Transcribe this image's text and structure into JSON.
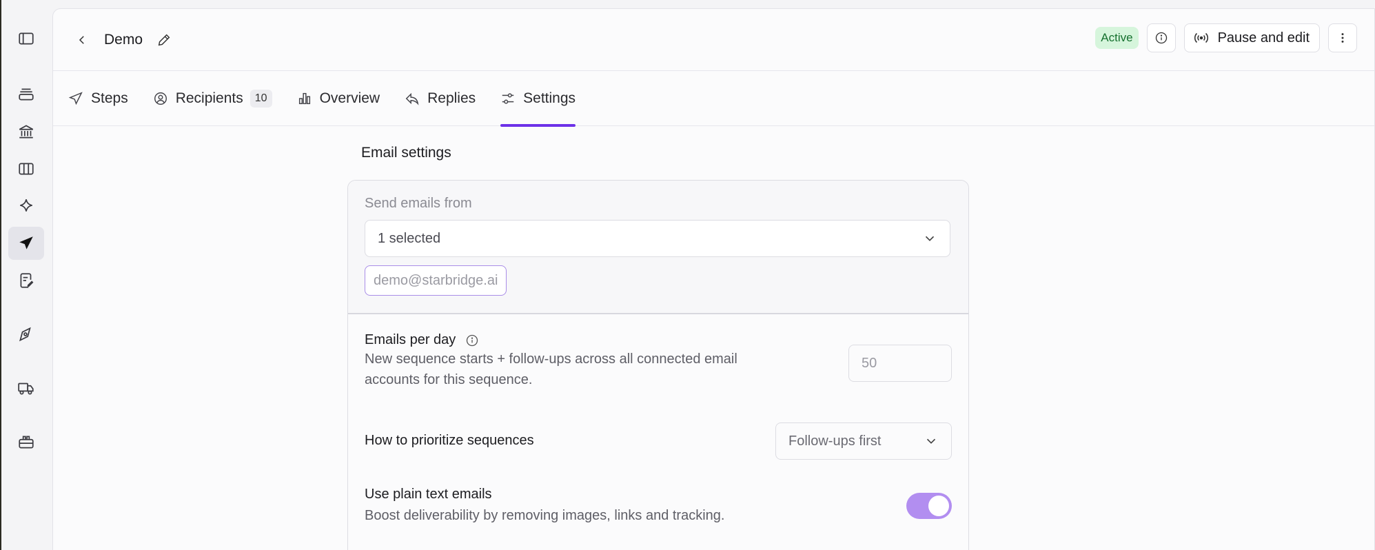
{
  "header": {
    "title": "Demo",
    "status": "Active",
    "pause_label": "Pause and edit"
  },
  "tabs": [
    {
      "label": "Steps",
      "icon": "send-icon"
    },
    {
      "label": "Recipients",
      "icon": "user-circle-icon",
      "count": "10"
    },
    {
      "label": "Overview",
      "icon": "bar-chart-icon"
    },
    {
      "label": "Replies",
      "icon": "reply-icon"
    },
    {
      "label": "Settings",
      "icon": "sliders-icon",
      "active": true
    }
  ],
  "sidebar": {
    "items": [
      {
        "icon": "panel-toggle-icon"
      },
      {
        "icon": "stack-icon"
      },
      {
        "icon": "bank-icon"
      },
      {
        "icon": "columns-icon"
      },
      {
        "icon": "sparkle-icon"
      },
      {
        "icon": "send-icon",
        "active": true
      },
      {
        "icon": "document-edit-icon"
      },
      {
        "icon": "compass-icon"
      },
      {
        "icon": "truck-icon"
      },
      {
        "icon": "briefcase-icon"
      }
    ]
  },
  "email_settings": {
    "section_title": "Email settings",
    "send_from_label": "Send emails from",
    "send_from_value": "1 selected",
    "selected_email": "demo@starbridge.ai",
    "per_day_label": "Emails per day",
    "per_day_desc_line1": "New sequence starts + follow-ups across all connected email",
    "per_day_desc_line2": "accounts for this sequence.",
    "per_day_value": "50",
    "prioritize_label": "How to prioritize sequences",
    "prioritize_value": "Follow-ups first",
    "plain_text_label": "Use plain text emails",
    "plain_text_desc": "Boost deliverability by removing images, links and tracking.",
    "plain_text_enabled": true
  },
  "colors": {
    "accent": "#6d31e8",
    "toggle_on": "#b28ef0",
    "active_badge_bg": "#d6f5dc",
    "active_badge_text": "#15702e"
  }
}
